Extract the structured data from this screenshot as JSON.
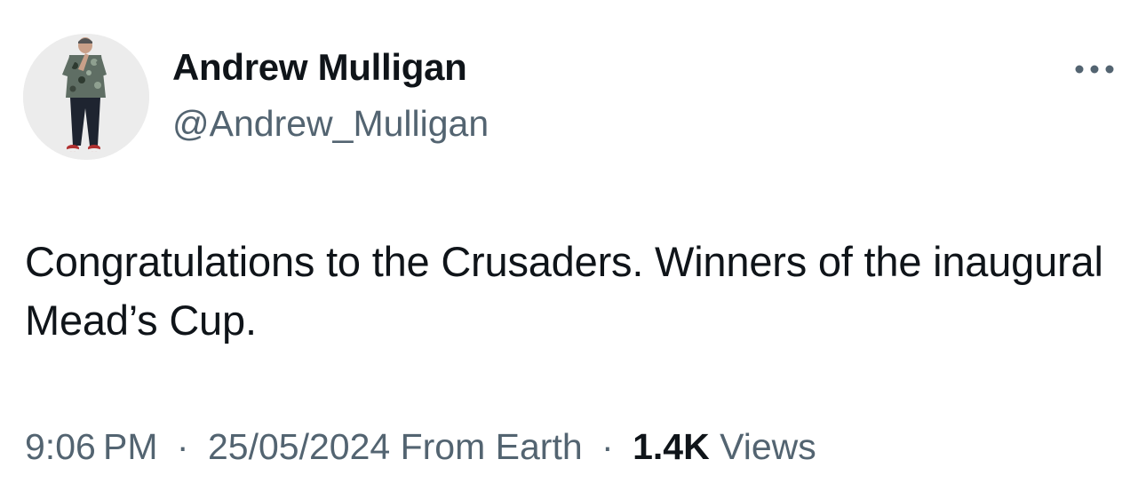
{
  "author": {
    "display_name": "Andrew Mulligan",
    "handle": "@Andrew_Mulligan"
  },
  "tweet": {
    "text": "Congratulations to the Crusaders. Winners of the inaugural Mead’s Cup."
  },
  "meta": {
    "time": "9:06 PM",
    "separator": "·",
    "date": "25/05/2024",
    "source": "From Earth",
    "views_count": "1.4K",
    "views_label": "Views"
  },
  "icons": {
    "more": "more-horizontal-icon"
  },
  "colors": {
    "text_primary": "#0f1419",
    "text_secondary": "#536471",
    "background": "#ffffff"
  }
}
